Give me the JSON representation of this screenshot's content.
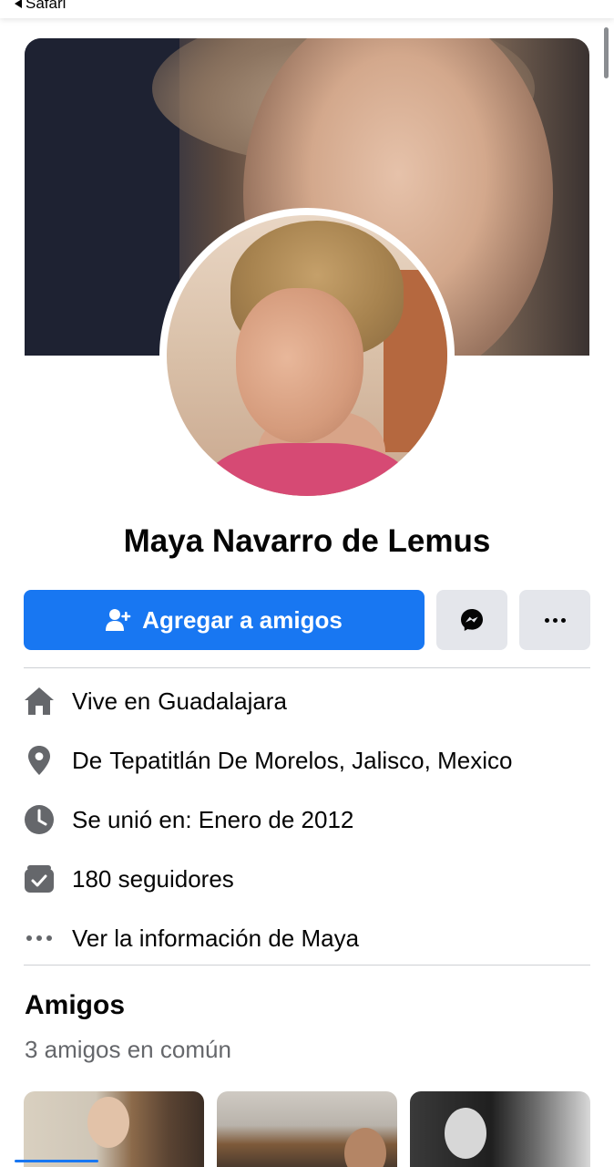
{
  "statusbar": {
    "back_label": "Safari"
  },
  "profile": {
    "name": "Maya Navarro de Lemus",
    "add_friend_label": "Agregar a amigos"
  },
  "info": {
    "lives": {
      "prefix": "Vive en",
      "value": "Guadalajara"
    },
    "from": {
      "prefix": "De",
      "value": "Tepatitlán De Morelos, Jalisco, Mexico"
    },
    "joined": {
      "text": "Se unió en: Enero de 2012"
    },
    "followers": {
      "text": "180 seguidores"
    },
    "more": {
      "text": "Ver la información de Maya"
    }
  },
  "friends": {
    "title": "Amigos",
    "mutual": "3 amigos en común"
  },
  "colors": {
    "accent": "#1877f2",
    "button_gray": "#e4e6eb",
    "secondary_text": "#65676b",
    "icon_gray": "#65676b"
  },
  "icons": {
    "add_friend": "person-plus-icon",
    "messenger": "messenger-icon",
    "more": "more-dots-icon",
    "home": "home-icon",
    "location": "location-pin-icon",
    "clock": "clock-icon",
    "followers": "followers-icon",
    "info_more": "ellipsis-icon"
  }
}
